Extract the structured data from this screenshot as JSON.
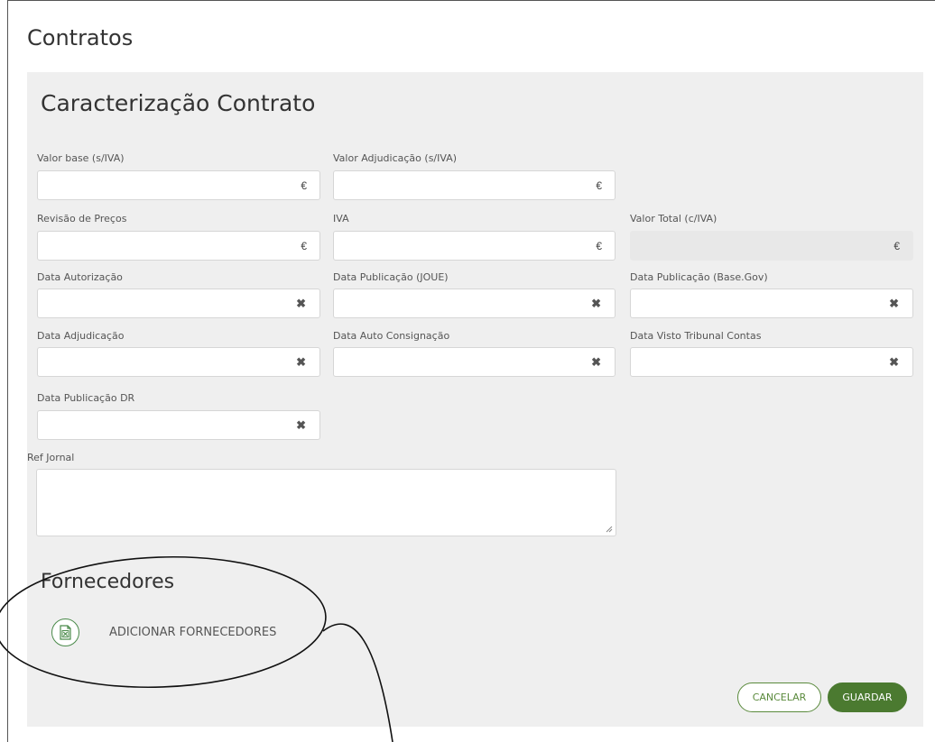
{
  "page": {
    "title": "Contratos"
  },
  "section": {
    "title": "Caracterização Contrato"
  },
  "fields": {
    "valor_base": {
      "label": "Valor base (s/IVA)",
      "value": "",
      "suffix": "€"
    },
    "valor_adjudicacao": {
      "label": "Valor Adjudicação (s/IVA)",
      "value": "",
      "suffix": "€"
    },
    "revisao_precos": {
      "label": "Revisão de Preços",
      "value": "",
      "suffix": "€"
    },
    "iva": {
      "label": "IVA",
      "value": "",
      "suffix": "€"
    },
    "valor_total": {
      "label": "Valor Total (c/IVA)",
      "value": "",
      "suffix": "€"
    },
    "data_autorizacao": {
      "label": "Data Autorização",
      "value": ""
    },
    "data_publicacao_joue": {
      "label": "Data Publicação (JOUE)",
      "value": ""
    },
    "data_publicacao_basegov": {
      "label": "Data Publicação (Base.Gov)",
      "value": ""
    },
    "data_adjudicacao": {
      "label": "Data Adjudicação",
      "value": ""
    },
    "data_auto_consignacao": {
      "label": "Data Auto Consignação",
      "value": ""
    },
    "data_visto_tribunal": {
      "label": "Data Visto Tribunal Contas",
      "value": ""
    },
    "data_publicacao_dr": {
      "label": "Data Publicação DR",
      "value": ""
    },
    "ref_jornal": {
      "label": "Ref Jornal",
      "value": ""
    }
  },
  "clear_glyph": "✖",
  "suppliers": {
    "title": "Fornecedores",
    "add_label": "ADICIONAR FORNECEDORES",
    "icon": "excel-file-icon"
  },
  "actions": {
    "cancel_label": "CANCELAR",
    "save_label": "GUARDAR"
  },
  "colors": {
    "accent": "#4b7a30",
    "panel_bg": "#efefef"
  }
}
